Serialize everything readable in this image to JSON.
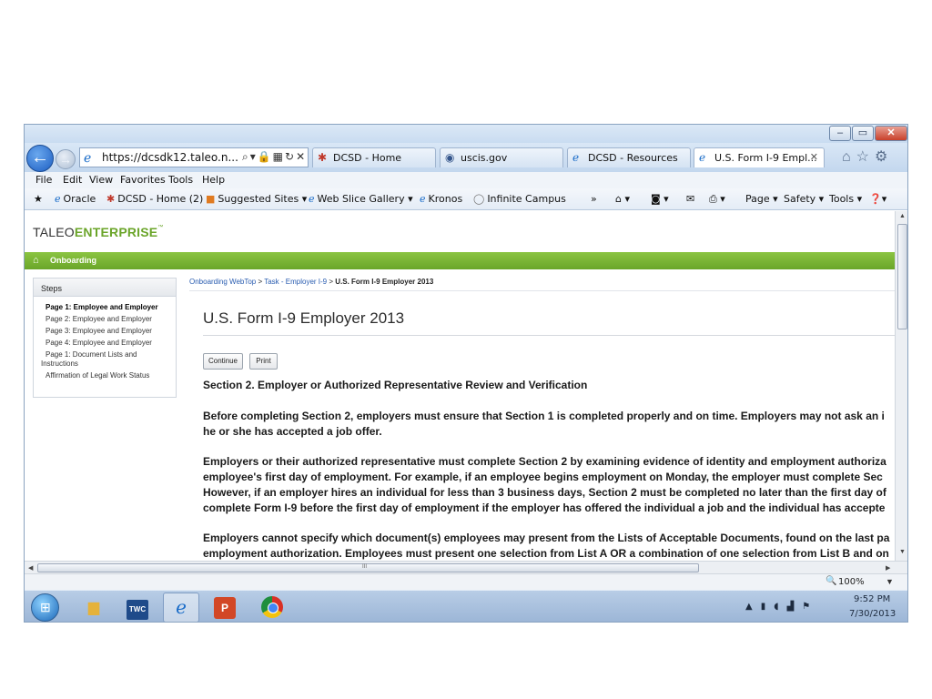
{
  "address": {
    "url": "https://dcsdk12.taleo.n..."
  },
  "tabs": [
    {
      "label": "DCSD - Home"
    },
    {
      "label": "uscis.gov"
    },
    {
      "label": "DCSD - Resources"
    },
    {
      "label": "U.S. Form I-9 Empl..."
    }
  ],
  "menu": [
    "File",
    "Edit",
    "View",
    "Favorites",
    "Tools",
    "Help"
  ],
  "favorites": [
    {
      "label": "Oracle"
    },
    {
      "label": "DCSD - Home (2)"
    },
    {
      "label": "Suggested Sites ▾"
    },
    {
      "label": "Web Slice Gallery ▾"
    },
    {
      "label": "Kronos"
    },
    {
      "label": "Infinite Campus"
    }
  ],
  "commands": {
    "page": "Page ▾",
    "safety": "Safety ▾",
    "tools": "Tools ▾"
  },
  "page": {
    "logo_plain": "TALEO",
    "logo_strong": "ENTERPRISE",
    "logo_tm": "™",
    "nav_label": "Onboarding",
    "steps_header": "Steps",
    "steps": [
      "Page 1: Employee and Employer",
      "Page 2: Employee and Employer",
      "Page 3: Employee and Employer",
      "Page 4: Employee and Employer",
      "Page 1: Document Lists and Instructions",
      "Affirmation of Legal Work Status"
    ],
    "breadcrumb": {
      "link1": "Onboarding WebTop",
      "sep": " > ",
      "link2": "Task - Employer I-9",
      "current": "U.S. Form I-9 Employer 2013"
    },
    "title": "U.S. Form I-9 Employer 2013",
    "continue_label": "Continue",
    "print_label": "Print",
    "section_title": "Section 2.  Employer or Authorized Representative Review and Verification",
    "para1": [
      "Before completing Section 2, employers must ensure that Section 1 is completed properly and on time.  Employers may not ask an i",
      "he or she has accepted a job offer."
    ],
    "para2": [
      "Employers or their authorized representative must complete Section 2 by examining evidence of identity and employment authoriza",
      "employee's first day of employment.  For example, if an employee begins employment on Monday, the employer must complete Sec",
      "However, if an employer hires an individual for less than 3 business days, Section 2 must be completed no later than the first day of",
      "complete Form I-9 before the first day of employment if the employer has offered the individual a job and the individual has accepte"
    ],
    "para3": [
      "Employers cannot specify which document(s) employees may present from the Lists of Acceptable Documents, found on the last pa",
      "employment authorization.  Employees must present one selection from List A OR a combination of one selection from List B and on"
    ]
  },
  "status": {
    "zoom": "100%",
    "scroll_mark": "III"
  },
  "taskbar": {
    "twc": "TWC",
    "ppt": "P",
    "time": "9:52 PM",
    "date": "7/30/2013"
  }
}
